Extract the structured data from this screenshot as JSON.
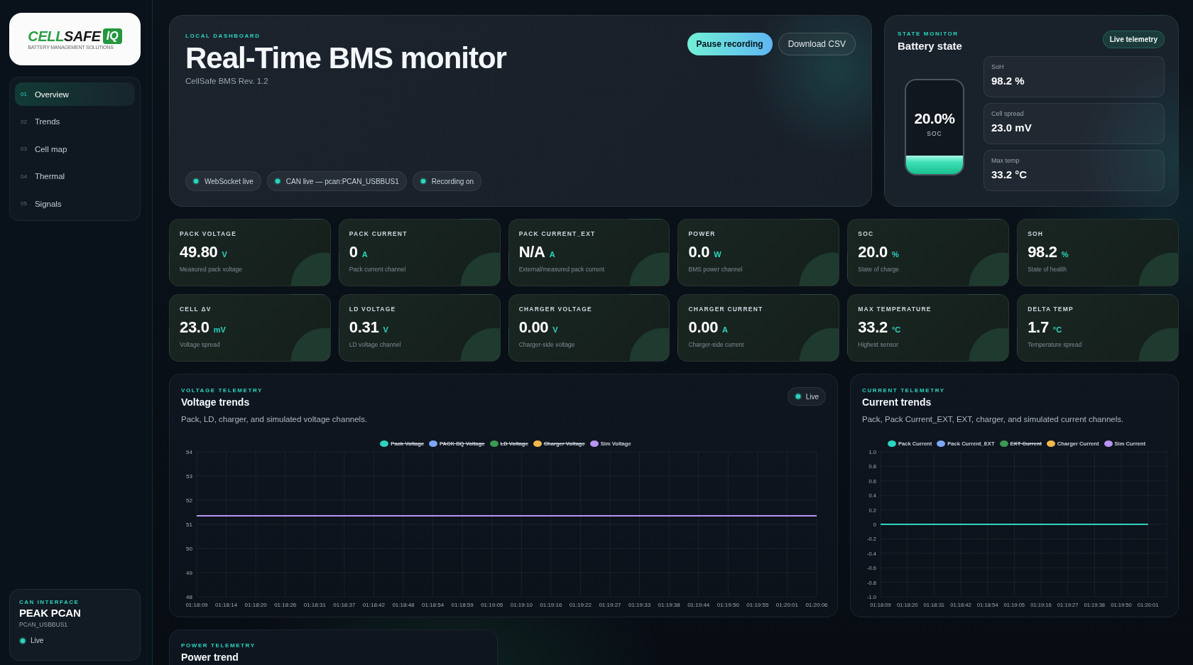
{
  "sidebar": {
    "logo": {
      "wordmark": [
        {
          "text": "CELL",
          "kind": "primary"
        },
        {
          "text": "SAFE",
          "kind": "secondary"
        }
      ],
      "suffix": "IQ",
      "tagline": "BATTERY MANAGEMENT SOLUTIONS"
    },
    "nav": [
      {
        "number": "01",
        "label": "Overview",
        "selected": true
      },
      {
        "number": "02",
        "label": "Trends",
        "selected": false
      },
      {
        "number": "03",
        "label": "Cell map",
        "selected": false
      },
      {
        "number": "04",
        "label": "Thermal",
        "selected": false
      },
      {
        "number": "05",
        "label": "Signals",
        "selected": false
      }
    ],
    "can_interface": {
      "eyebrow": "CAN INTERFACE",
      "title": "PEAK PCAN",
      "device": "PCAN_USBBUS1",
      "status": "Live"
    }
  },
  "header": {
    "eyebrow": "LOCAL DASHBOARD",
    "title": "Real-Time BMS monitor",
    "subtitle": "CellSafe BMS Rev. 1.2",
    "buttons": [
      {
        "label": "Pause recording",
        "kind": "primary"
      },
      {
        "label": "Download CSV",
        "kind": "secondary"
      }
    ],
    "status_chips": [
      {
        "label": "WebSocket live"
      },
      {
        "label": "CAN live — pcan:PCAN_USBBUS1"
      },
      {
        "label": "Recording on"
      }
    ]
  },
  "battery_state": {
    "eyebrow": "STATE MONITOR",
    "title": "Battery state",
    "tag": "Live telemetry",
    "gauge": {
      "reading": "20.0%",
      "label": "SOC",
      "level": 0.2
    },
    "stats": [
      {
        "label": "SoH",
        "value": "98.2 %"
      },
      {
        "label": "Cell spread",
        "value": "23.0 mV"
      },
      {
        "label": "Max temp",
        "value": "33.2 °C"
      }
    ]
  },
  "metrics": [
    {
      "label": "PACK VOLTAGE",
      "value": "49.80",
      "unit": "V",
      "description": "Measured pack voltage"
    },
    {
      "label": "PACK CURRENT",
      "value": "0",
      "unit": "A",
      "description": "Pack current channel"
    },
    {
      "label": "PACK CURRENT_EXT",
      "value": "N/A",
      "unit": "A",
      "description": "External/measured pack current"
    },
    {
      "label": "POWER",
      "value": "0.0",
      "unit": "W",
      "description": "BMS power channel"
    },
    {
      "label": "SOC",
      "value": "20.0",
      "unit": "%",
      "description": "State of charge"
    },
    {
      "label": "SOH",
      "value": "98.2",
      "unit": "%",
      "description": "State of health"
    },
    {
      "label": "CELL ΔV",
      "value": "23.0",
      "unit": "mV",
      "description": "Voltage spread"
    },
    {
      "label": "LD VOLTAGE",
      "value": "0.31",
      "unit": "V",
      "description": "LD voltage channel"
    },
    {
      "label": "CHARGER VOLTAGE",
      "value": "0.00",
      "unit": "V",
      "description": "Charger-side voltage"
    },
    {
      "label": "CHARGER CURRENT",
      "value": "0.00",
      "unit": "A",
      "description": "Charger-side current"
    },
    {
      "label": "MAX TEMPERATURE",
      "value": "33.2",
      "unit": "°C",
      "description": "Highest sensor"
    },
    {
      "label": "DELTA TEMP",
      "value": "1.7",
      "unit": "°C",
      "description": "Temperature spread"
    }
  ],
  "voltage_telemetry": {
    "eyebrow": "VOLTAGE TELEMETRY",
    "title": "Voltage trends",
    "description": "Pack, LD, charger, and simulated voltage channels.",
    "status": "Live",
    "legend": [
      {
        "label": "Pack Voltage",
        "color": "#2dd4bf",
        "hidden": true
      },
      {
        "label": "PACK BQ Voltage",
        "color": "#7ea6f6",
        "hidden": true
      },
      {
        "label": "LD Voltage",
        "color": "#3a9a52",
        "hidden": true
      },
      {
        "label": "Charger Voltage",
        "color": "#f5b74a",
        "hidden": true
      },
      {
        "label": "Sim Voltage",
        "color": "#b794f6",
        "hidden": false
      }
    ],
    "chart_data": {
      "type": "line",
      "grid": true,
      "categories": [
        "01:18:09",
        "01:18:14",
        "01:18:20",
        "01:18:26",
        "01:18:31",
        "01:18:37",
        "01:18:42",
        "01:18:48",
        "01:18:54",
        "01:18:59",
        "01:19:05",
        "01:19:10",
        "01:19:16",
        "01:19:22",
        "01:19:27",
        "01:19:33",
        "01:19:38",
        "01:19:44",
        "01:19:50",
        "01:19:55",
        "01:20:01",
        "01:20:06"
      ],
      "ylim": [
        48,
        54
      ],
      "yticks": [
        48,
        49,
        50,
        51,
        52,
        53,
        54
      ],
      "series": [
        {
          "color": "#b794f6",
          "values": [
            51.35,
            51.35,
            51.35,
            51.35,
            51.35,
            51.35,
            51.35,
            51.35,
            51.35,
            51.35,
            51.35,
            51.35,
            51.35,
            51.35,
            51.35,
            51.35,
            51.35,
            51.35,
            51.35,
            51.35,
            51.35,
            51.35
          ]
        }
      ]
    }
  },
  "current_telemetry": {
    "eyebrow": "CURRENT TELEMETRY",
    "title": "Current trends",
    "description": "Pack, Pack Current_EXT, EXT, charger, and simulated current channels.",
    "legend": [
      {
        "label": "Pack Current",
        "color": "#2dd4bf",
        "hidden": false
      },
      {
        "label": "Pack Current_EXT",
        "color": "#7ea6f6",
        "hidden": false
      },
      {
        "label": "EXT Current",
        "color": "#3a9a52",
        "hidden": true
      },
      {
        "label": "Charger Current",
        "color": "#f5b74a",
        "hidden": false
      },
      {
        "label": "Sim Current",
        "color": "#b794f6",
        "hidden": false
      }
    ],
    "chart_data": {
      "type": "line",
      "grid": true,
      "categories": [
        "01:18:09",
        "01:18:20",
        "01:18:31",
        "01:18:42",
        "01:18:54",
        "01:19:05",
        "01:19:16",
        "01:19:27",
        "01:19:38",
        "01:19:50",
        "01:20:01"
      ],
      "ylim": [
        -1,
        1
      ],
      "yticks": [
        {
          "value": -1,
          "label": "-1.0"
        },
        -0.8,
        -0.6,
        -0.4,
        -0.2,
        0,
        0.2,
        0.4,
        0.6,
        0.8,
        {
          "value": 1,
          "label": "1.0"
        }
      ],
      "series": [
        {
          "color": "#2dd4bf",
          "values": [
            0,
            0,
            0,
            0,
            0,
            0,
            0,
            0,
            0,
            0,
            0
          ]
        }
      ]
    }
  },
  "power_telemetry": {
    "eyebrow": "POWER TELEMETRY",
    "title": "Power trend"
  }
}
